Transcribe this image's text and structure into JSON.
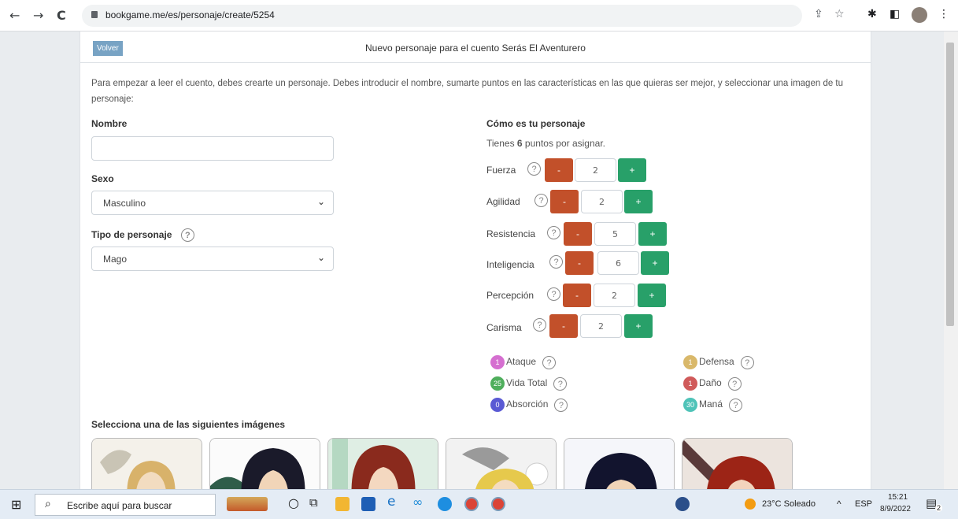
{
  "browser": {
    "url": "bookgame.me/es/personaje/create/5254"
  },
  "header": {
    "back_label": "Volver",
    "title": "Nuevo personaje para el cuento Serás El Aventurero"
  },
  "intro": "Para empezar a leer el cuento, debes crearte un personaje. Debes introducir el nombre, sumarte puntos en las características en las que quieras ser mejor, y seleccionar una imagen de tu personaje:",
  "form": {
    "name_label": "Nombre",
    "name_value": "",
    "sex_label": "Sexo",
    "sex_value": "Masculino",
    "type_label": "Tipo de personaje",
    "type_value": "Mago"
  },
  "character": {
    "heading": "Cómo es tu personaje",
    "points_prefix": "Tienes ",
    "points": "6",
    "points_suffix": " puntos por asignar.",
    "minus": "-",
    "plus": "+",
    "attributes": [
      {
        "name": "Fuerza",
        "value": "2"
      },
      {
        "name": "Agilidad",
        "value": "2"
      },
      {
        "name": "Resistencia",
        "value": "5"
      },
      {
        "name": "Inteligencia",
        "value": "6"
      },
      {
        "name": "Percepción",
        "value": "2"
      },
      {
        "name": "Carisma",
        "value": "2"
      }
    ],
    "stats": [
      {
        "label": "Ataque",
        "value": "1",
        "color": "#d56fd0"
      },
      {
        "label": "Vida Total",
        "value": "25",
        "color": "#4fae5c"
      },
      {
        "label": "Absorción",
        "value": "0",
        "color": "#5a5ad4"
      },
      {
        "label": "Defensa",
        "value": "1",
        "color": "#d9b86a"
      },
      {
        "label": "Daño",
        "value": "1",
        "color": "#d05a5a"
      },
      {
        "label": "Maná",
        "value": "30",
        "color": "#4fc3b8"
      }
    ]
  },
  "images_heading": "Selecciona una de las siguientes imágenes",
  "taskbar": {
    "search_placeholder": "Escribe aquí para buscar",
    "weather": "23°C  Soleado",
    "lang": "ESP",
    "time": "15:21",
    "date": "8/9/2022",
    "notif_count": "2"
  }
}
